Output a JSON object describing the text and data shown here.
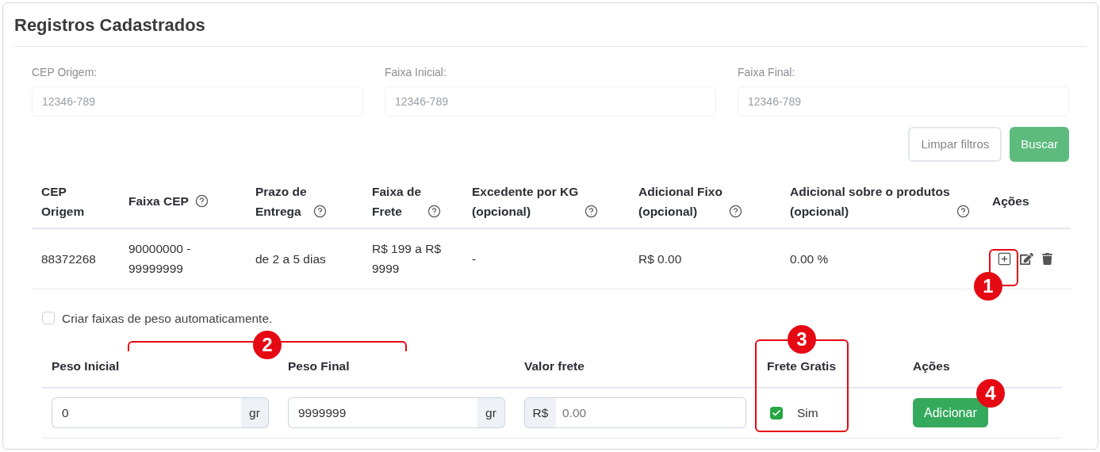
{
  "title": "Registros Cadastrados",
  "filters": [
    {
      "label": "CEP Origem:",
      "placeholder": "12346-789"
    },
    {
      "label": "Faixa Inicial:",
      "placeholder": "12346-789"
    },
    {
      "label": "Faixa Final:",
      "placeholder": "12346-789"
    }
  ],
  "filter_buttons": [
    {
      "label": "Limpar filtros",
      "kind": "outline"
    },
    {
      "label": "Buscar",
      "kind": "primary"
    }
  ],
  "table": {
    "columns": [
      {
        "lines": [
          "CEP",
          "Origem"
        ],
        "help": false
      },
      {
        "lines": [
          "Faixa CEP"
        ],
        "help": true
      },
      {
        "lines": [
          "Prazo de",
          "Entrega"
        ],
        "help": true
      },
      {
        "lines": [
          "Faixa de",
          "Frete"
        ],
        "help": true
      },
      {
        "lines": [
          "Excedente por KG",
          "(opcional)"
        ],
        "help": true
      },
      {
        "lines": [
          "Adicional Fixo",
          "(opcional)"
        ],
        "help": true
      },
      {
        "lines": [
          "Adicional sobre o produtos",
          "(opcional)"
        ],
        "help": true
      },
      {
        "lines": [
          "Ações"
        ],
        "help": false
      }
    ],
    "rows": [
      {
        "cells": [
          [
            "88372268"
          ],
          [
            "90000000 -",
            "99999999"
          ],
          [
            "de 2 a 5 dias"
          ],
          [
            "R$ 199 a R$",
            "9999"
          ],
          [
            "-"
          ],
          [
            "R$ 0.00"
          ],
          [
            "0.00 %"
          ]
        ]
      }
    ]
  },
  "weights": {
    "auto": {
      "label": "Criar faixas de peso automaticamente.",
      "checked": false
    },
    "columns": [
      "Peso Inicial",
      "Peso Final",
      "Valor frete",
      "Frete Gratis",
      "Ações"
    ],
    "row": {
      "peso_inicial": {
        "value": "0",
        "unit": "gr"
      },
      "peso_final": {
        "value": "9999999",
        "unit": "gr"
      },
      "valor_frete": {
        "prefix": "R$",
        "placeholder": "0.00"
      },
      "frete_gratis": {
        "label": "Sim",
        "checked": true
      },
      "button": "Adicionar"
    }
  },
  "callouts": [
    "1",
    "2",
    "3",
    "4"
  ]
}
